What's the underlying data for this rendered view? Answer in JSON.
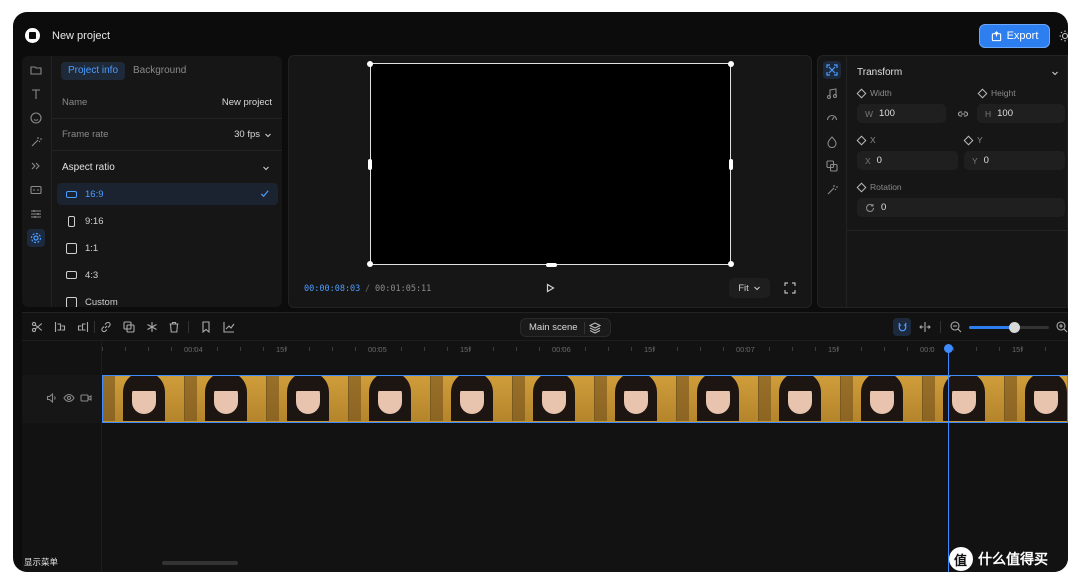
{
  "app": {
    "title": "New project",
    "export_label": "Export"
  },
  "left_panel": {
    "tabs": [
      "Project info",
      "Background"
    ],
    "name_label": "Name",
    "name_value": "New project",
    "frame_rate_label": "Frame rate",
    "frame_rate_value": "30 fps",
    "aspect_title": "Aspect ratio",
    "ratios": [
      "16:9",
      "9:16",
      "1:1",
      "4:3",
      "Custom"
    ],
    "selected_ratio": "16:9"
  },
  "preview": {
    "current_time": "00:00:08:03",
    "separator": "/",
    "total_time": "00:01:05:11",
    "fit_label": "Fit"
  },
  "transform": {
    "title": "Transform",
    "width_label": "Width",
    "height_label": "Height",
    "w_prefix": "W",
    "w_value": "100",
    "h_prefix": "H",
    "h_value": "100",
    "x_label": "X",
    "y_label": "Y",
    "x_prefix": "X",
    "x_value": "0",
    "y_prefix": "Y",
    "y_value": "0",
    "rotation_label": "Rotation",
    "rotation_value": "0"
  },
  "timeline": {
    "scene_label": "Main scene",
    "ruler_labels": [
      "00:04",
      "15f",
      "00:05",
      "15f",
      "00:06",
      "15f",
      "00:07",
      "15f",
      "00:0",
      "15f"
    ],
    "zoom_level": 0.56
  },
  "footer": {
    "menu_label": "显示菜单"
  },
  "watermark": {
    "text": "什么值得买"
  }
}
